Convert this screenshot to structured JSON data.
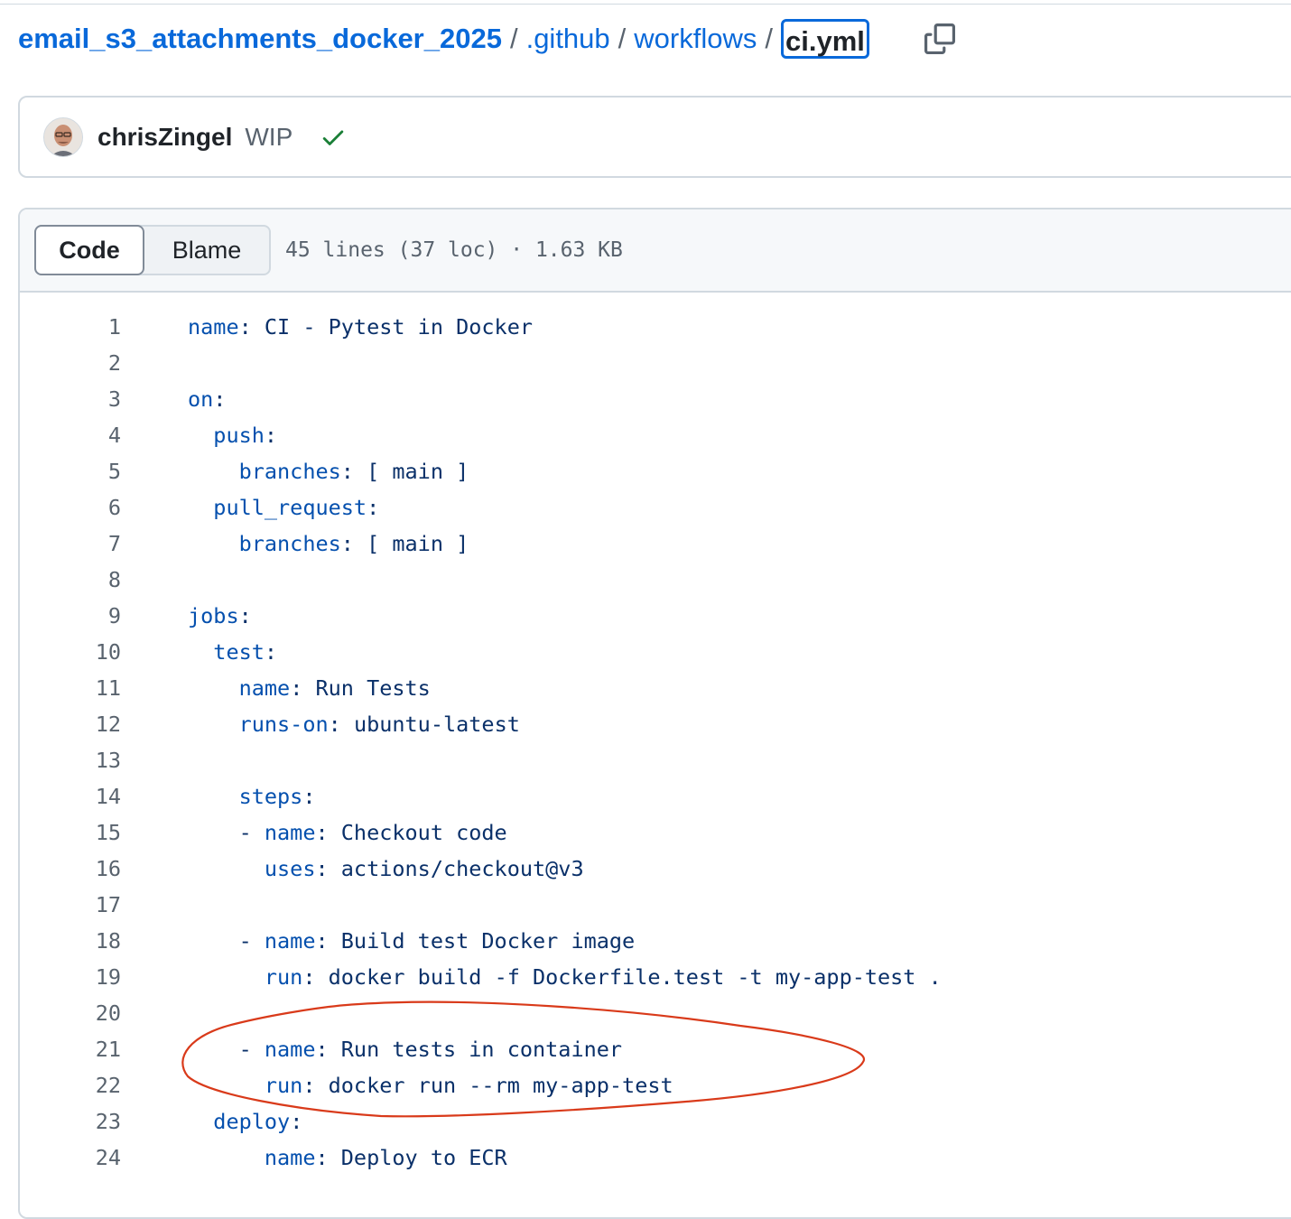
{
  "breadcrumb": {
    "repo": "email_s3_attachments_docker_2025",
    "separator": "/",
    "folders": [
      ".github",
      "workflows"
    ],
    "current_file": "ci.yml"
  },
  "commit": {
    "author": "chrisZingel",
    "message": "WIP",
    "status": "success"
  },
  "file": {
    "tabs": [
      "Code",
      "Blame"
    ],
    "active_tab": "Code",
    "meta": "45 lines (37 loc) · 1.63 KB"
  },
  "code_lines": [
    {
      "n": "1",
      "indent": "",
      "prefix": "",
      "key": "name",
      "value": "CI - Pytest in Docker"
    },
    {
      "n": "2",
      "indent": "",
      "prefix": "",
      "key": "",
      "value": ""
    },
    {
      "n": "3",
      "indent": "",
      "prefix": "",
      "key": "on",
      "value": ""
    },
    {
      "n": "4",
      "indent": "  ",
      "prefix": "",
      "key": "push",
      "value": ""
    },
    {
      "n": "5",
      "indent": "    ",
      "prefix": "",
      "key": "branches",
      "value": "[ main ]"
    },
    {
      "n": "6",
      "indent": "  ",
      "prefix": "",
      "key": "pull_request",
      "value": ""
    },
    {
      "n": "7",
      "indent": "    ",
      "prefix": "",
      "key": "branches",
      "value": "[ main ]"
    },
    {
      "n": "8",
      "indent": "",
      "prefix": "",
      "key": "",
      "value": ""
    },
    {
      "n": "9",
      "indent": "",
      "prefix": "",
      "key": "jobs",
      "value": ""
    },
    {
      "n": "10",
      "indent": "  ",
      "prefix": "",
      "key": "test",
      "value": ""
    },
    {
      "n": "11",
      "indent": "    ",
      "prefix": "",
      "key": "name",
      "value": "Run Tests"
    },
    {
      "n": "12",
      "indent": "    ",
      "prefix": "",
      "key": "runs-on",
      "value": "ubuntu-latest"
    },
    {
      "n": "13",
      "indent": "",
      "prefix": "",
      "key": "",
      "value": ""
    },
    {
      "n": "14",
      "indent": "    ",
      "prefix": "",
      "key": "steps",
      "value": ""
    },
    {
      "n": "15",
      "indent": "    ",
      "prefix": "- ",
      "key": "name",
      "value": "Checkout code"
    },
    {
      "n": "16",
      "indent": "      ",
      "prefix": "",
      "key": "uses",
      "value": "actions/checkout@v3"
    },
    {
      "n": "17",
      "indent": "",
      "prefix": "",
      "key": "",
      "value": ""
    },
    {
      "n": "18",
      "indent": "    ",
      "prefix": "- ",
      "key": "name",
      "value": "Build test Docker image"
    },
    {
      "n": "19",
      "indent": "      ",
      "prefix": "",
      "key": "run",
      "value": "docker build -f Dockerfile.test -t my-app-test ."
    },
    {
      "n": "20",
      "indent": "",
      "prefix": "",
      "key": "",
      "value": ""
    },
    {
      "n": "21",
      "indent": "    ",
      "prefix": "- ",
      "key": "name",
      "value": "Run tests in container"
    },
    {
      "n": "22",
      "indent": "      ",
      "prefix": "",
      "key": "run",
      "value": "docker run --rm my-app-test"
    },
    {
      "n": "23",
      "indent": "  ",
      "prefix": "",
      "key": "deploy",
      "value": ""
    },
    {
      "n": "24",
      "indent": "      ",
      "prefix": "",
      "key": "name",
      "value": "Deploy to ECR"
    }
  ],
  "colors": {
    "link": "#0969da",
    "key": "#0550ae",
    "text": "#1f2328",
    "success": "#1a7f37",
    "annotation": "#d93a1a"
  }
}
